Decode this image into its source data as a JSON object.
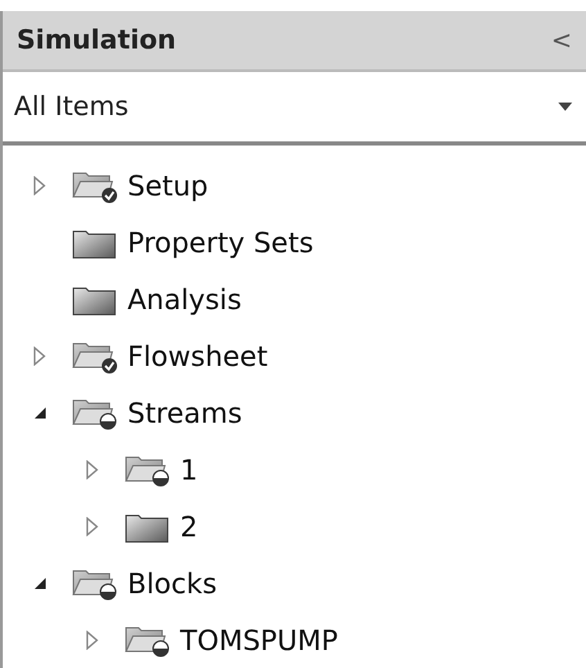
{
  "panel": {
    "title": "Simulation",
    "collapse_glyph": "<"
  },
  "filter": {
    "value": "All Items"
  },
  "tree": [
    {
      "label": "Setup",
      "expandable": true,
      "expanded": false,
      "kind": "done"
    },
    {
      "label": "Property Sets",
      "expandable": false,
      "kind": "empty"
    },
    {
      "label": "Analysis",
      "expandable": false,
      "kind": "empty"
    },
    {
      "label": "Flowsheet",
      "expandable": true,
      "expanded": false,
      "kind": "done"
    },
    {
      "label": "Streams",
      "expandable": true,
      "expanded": true,
      "kind": "incomplete",
      "children": [
        {
          "label": "1",
          "expandable": true,
          "expanded": false,
          "kind": "incomplete"
        },
        {
          "label": "2",
          "expandable": true,
          "expanded": false,
          "kind": "empty"
        }
      ]
    },
    {
      "label": "Blocks",
      "expandable": true,
      "expanded": true,
      "kind": "incomplete",
      "children": [
        {
          "label": "TOMSPUMP",
          "expandable": true,
          "expanded": false,
          "kind": "incomplete"
        }
      ]
    }
  ]
}
